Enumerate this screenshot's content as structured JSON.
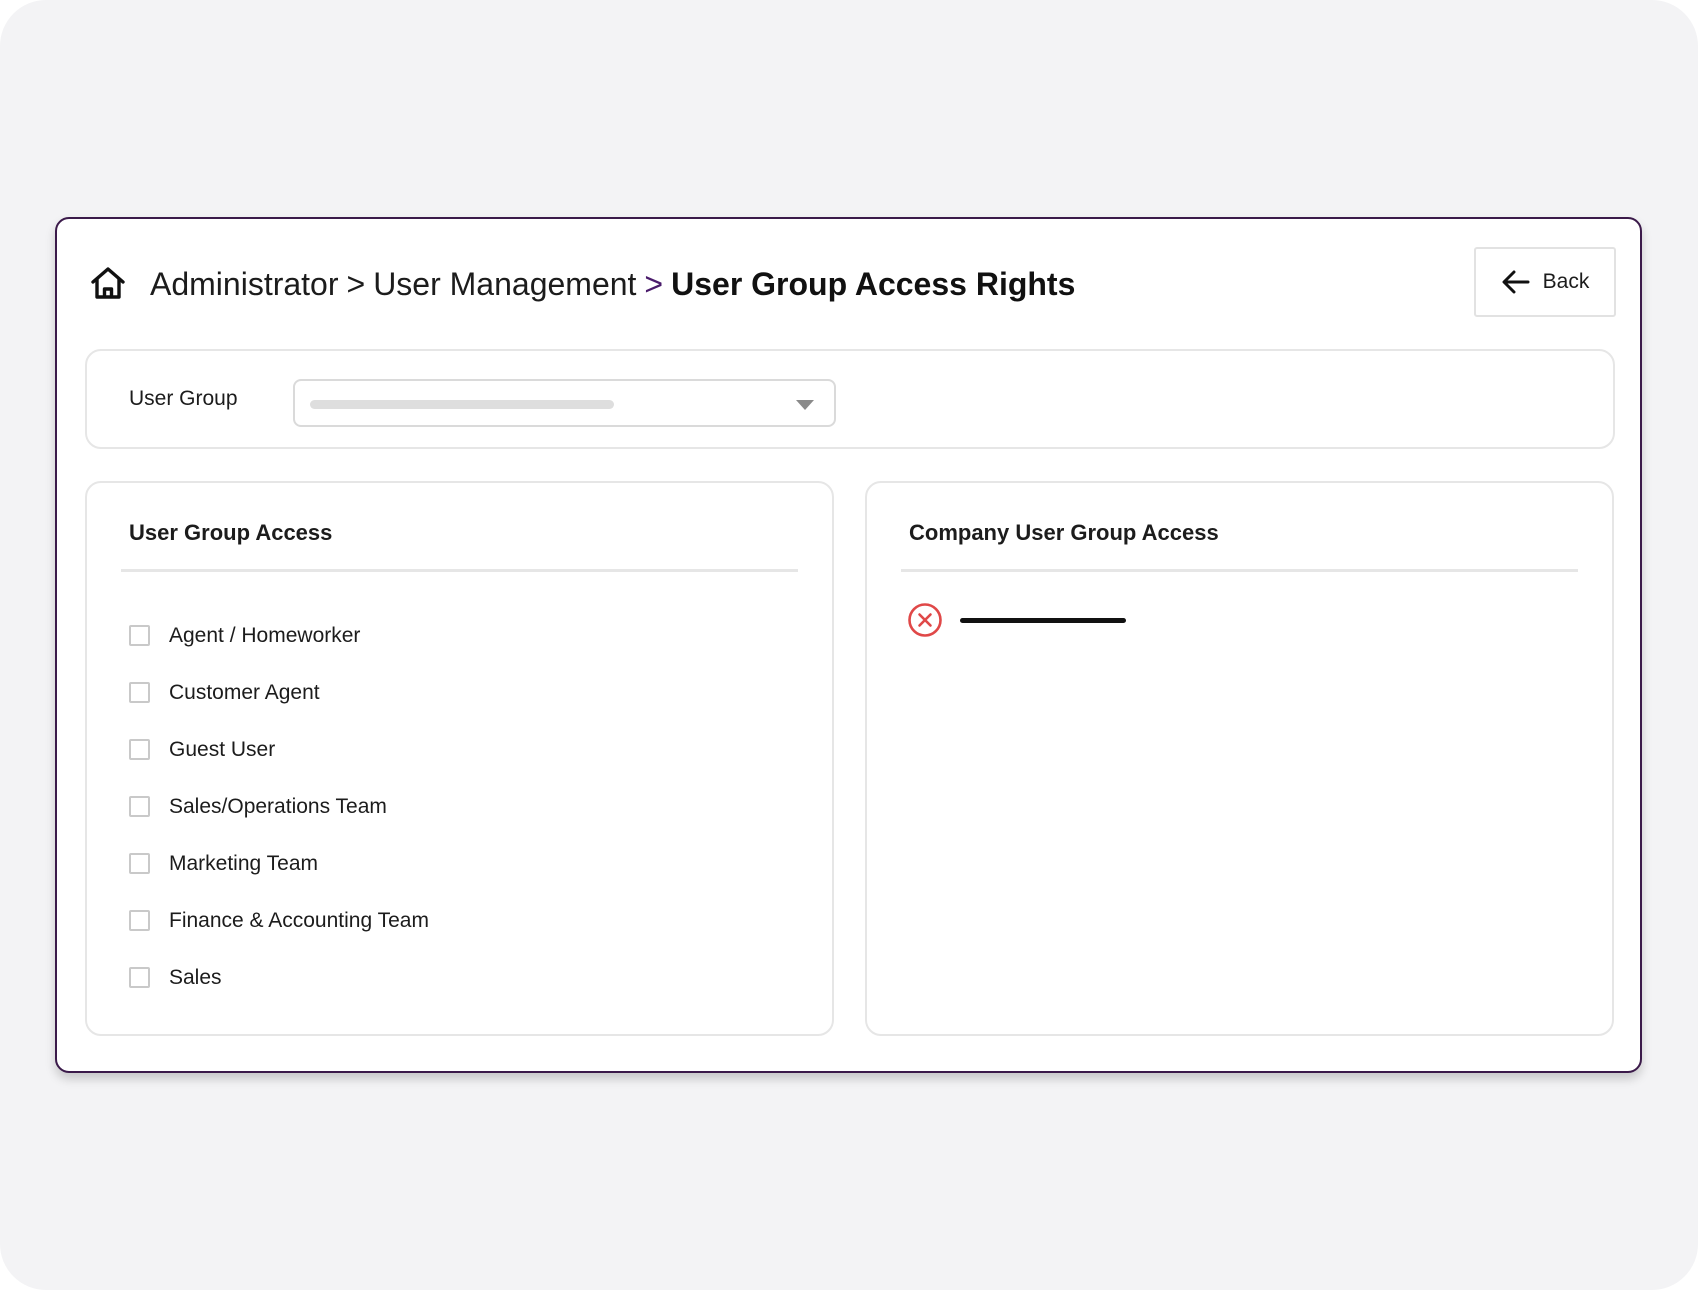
{
  "breadcrumb": {
    "items": [
      "Administrator",
      "User Management"
    ],
    "separator": ">",
    "current": "User Group Access Rights"
  },
  "header": {
    "back_label": "Back",
    "icons": {
      "home": "home-icon",
      "back": "arrow-left-icon"
    }
  },
  "filter": {
    "user_group_label": "User Group",
    "user_group_value": ""
  },
  "user_group_access": {
    "title": "User Group Access",
    "items": [
      {
        "label": "Agent / Homeworker",
        "checked": false
      },
      {
        "label": "Customer Agent",
        "checked": false
      },
      {
        "label": "Guest User",
        "checked": false
      },
      {
        "label": "Sales/Operations Team",
        "checked": false
      },
      {
        "label": "Marketing Team",
        "checked": false
      },
      {
        "label": "Finance & Accounting Team",
        "checked": false
      },
      {
        "label": "Sales",
        "checked": false
      }
    ]
  },
  "company_user_group_access": {
    "title": "Company User Group Access",
    "items": [
      {
        "label": "",
        "icon": "remove-circle-icon"
      }
    ]
  },
  "colors": {
    "frame_border": "#3b1a4a",
    "breadcrumb_accent": "#4a1b6b",
    "remove_icon": "#e04848",
    "background": "#f3f3f5"
  }
}
